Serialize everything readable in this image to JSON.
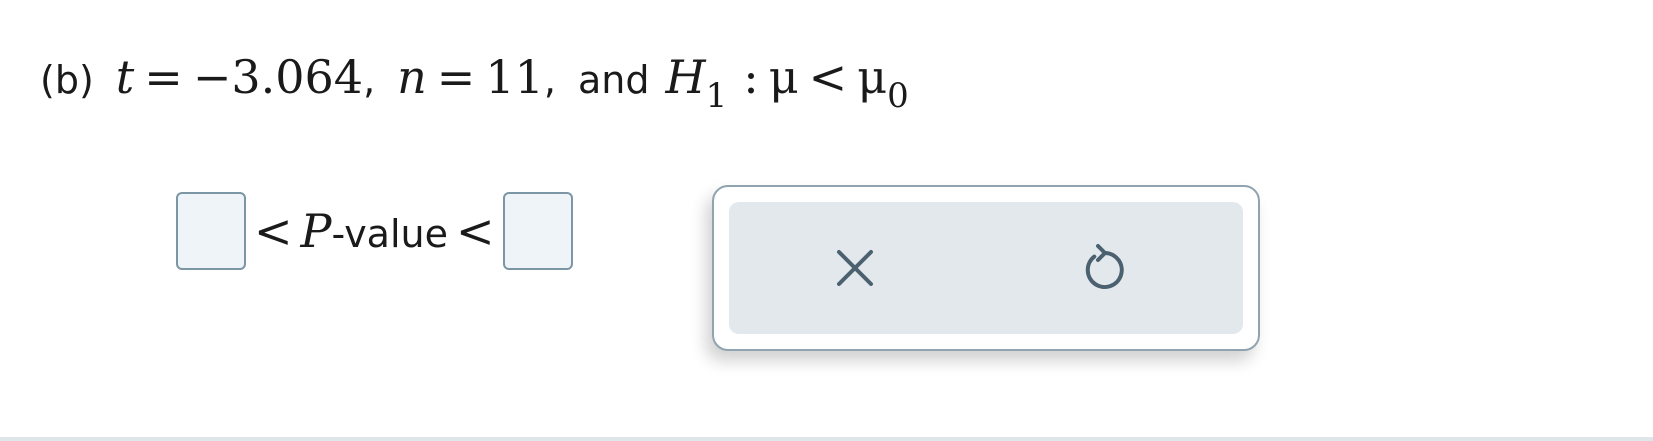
{
  "question": {
    "part_label": "(b)",
    "t_var": "t",
    "eq1": "=",
    "t_value": "−3.064",
    "comma1": ",",
    "n_var": "n",
    "eq2": "=",
    "n_value": "11",
    "comma2": ",",
    "and_text": "and",
    "h_var": "H",
    "h_sub": "1",
    "colon": ":",
    "mu": "μ",
    "lt": "<",
    "mu0": "μ",
    "mu0_sub": "0"
  },
  "answer": {
    "lt_left": "<",
    "p_var": "P",
    "value_text": "-value",
    "lt_right": "<",
    "lower_bound_value": "",
    "upper_bound_value": ""
  },
  "toolpad": {
    "clear_icon": "close-icon",
    "undo_icon": "undo-icon",
    "icon_color": "#4b6170"
  }
}
